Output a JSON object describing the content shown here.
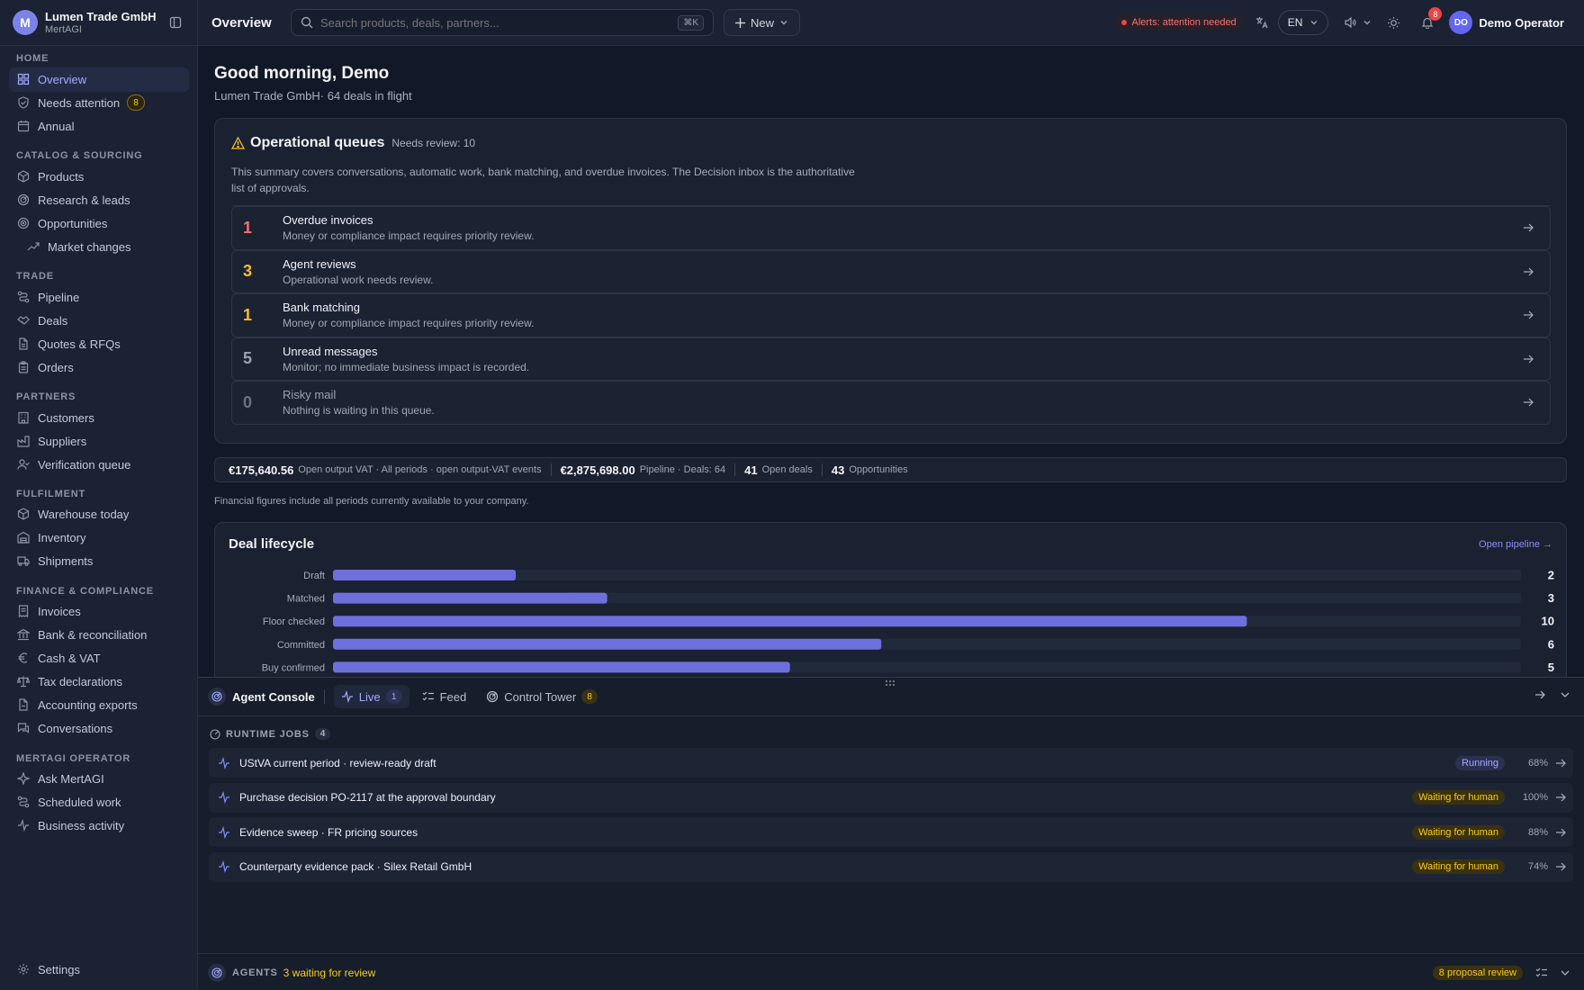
{
  "brand": {
    "name": "Lumen Trade GmbH",
    "sub": "MertAGI",
    "logo": "M"
  },
  "sidebar": {
    "sections": [
      {
        "label": "HOME",
        "items": [
          {
            "label": "Overview",
            "icon": "grid-icon",
            "active": true
          },
          {
            "label": "Needs attention",
            "icon": "shield-check-icon",
            "badge": "8"
          },
          {
            "label": "Annual",
            "icon": "calendar-icon"
          }
        ]
      },
      {
        "label": "CATALOG & SOURCING",
        "items": [
          {
            "label": "Products",
            "icon": "box-icon"
          },
          {
            "label": "Research & leads",
            "icon": "radar-icon"
          },
          {
            "label": "Opportunities",
            "icon": "target-icon"
          },
          {
            "label": "Market changes",
            "icon": "trend-icon",
            "sub": true
          }
        ]
      },
      {
        "label": "TRADE",
        "items": [
          {
            "label": "Pipeline",
            "icon": "route-icon"
          },
          {
            "label": "Deals",
            "icon": "handshake-icon"
          },
          {
            "label": "Quotes & RFQs",
            "icon": "file-icon"
          },
          {
            "label": "Orders",
            "icon": "clipboard-icon"
          }
        ]
      },
      {
        "label": "PARTNERS",
        "items": [
          {
            "label": "Customers",
            "icon": "building-icon"
          },
          {
            "label": "Suppliers",
            "icon": "factory-icon"
          },
          {
            "label": "Verification queue",
            "icon": "user-check-icon"
          }
        ]
      },
      {
        "label": "FULFILMENT",
        "items": [
          {
            "label": "Warehouse today",
            "icon": "box-icon"
          },
          {
            "label": "Inventory",
            "icon": "warehouse-icon"
          },
          {
            "label": "Shipments",
            "icon": "truck-icon"
          }
        ]
      },
      {
        "label": "FINANCE & COMPLIANCE",
        "items": [
          {
            "label": "Invoices",
            "icon": "receipt-icon"
          },
          {
            "label": "Bank & reconciliation",
            "icon": "bank-icon"
          },
          {
            "label": "Cash & VAT",
            "icon": "euro-icon"
          },
          {
            "label": "Tax declarations",
            "icon": "scale-icon"
          },
          {
            "label": "Accounting exports",
            "icon": "export-icon"
          },
          {
            "label": "Conversations",
            "icon": "chat-icon"
          }
        ]
      },
      {
        "label": "MERTAGI OPERATOR",
        "items": [
          {
            "label": "Ask MertAGI",
            "icon": "sparkle-icon"
          },
          {
            "label": "Scheduled work",
            "icon": "route-icon"
          },
          {
            "label": "Business activity",
            "icon": "activity-icon"
          }
        ]
      }
    ],
    "settings": "Settings"
  },
  "topbar": {
    "title": "Overview",
    "search_placeholder": "Search products, deals, partners...",
    "search_kbd": "⌘K",
    "new_label": "New",
    "alert": "Alerts: attention needed",
    "lang": "EN",
    "bell_count": "8",
    "avatar": "DO",
    "user": "Demo Operator"
  },
  "greeting": {
    "title": "Good morning, Demo",
    "sub": "Lumen Trade GmbH· 64 deals in flight"
  },
  "queues": {
    "title": "Operational queues",
    "needs_review": "Needs review: 10",
    "description": "This summary covers conversations, automatic work, bank matching, and overdue invoices. The Decision inbox is the authoritative list of approvals.",
    "rows": [
      {
        "count": "1",
        "name": "Overdue invoices",
        "note": "Money or compliance impact requires priority review.",
        "color": "#f87171"
      },
      {
        "count": "3",
        "name": "Agent reviews",
        "note": "Operational work needs review.",
        "color": "#fbbf24"
      },
      {
        "count": "1",
        "name": "Bank matching",
        "note": "Money or compliance impact requires priority review.",
        "color": "#fbbf24"
      },
      {
        "count": "5",
        "name": "Unread messages",
        "note": "Monitor; no immediate business impact is recorded.",
        "color": "#9ca3af"
      },
      {
        "count": "0",
        "name": "Risky mail",
        "note": "Nothing is waiting in this queue.",
        "color": "#6b7280"
      }
    ]
  },
  "metrics": [
    {
      "value": "€175,640.56",
      "label": "Open output VAT · All periods · open output-VAT events"
    },
    {
      "value": "€2,875,698.00",
      "label": "Pipeline · Deals: 64"
    },
    {
      "value": "41",
      "label": "Open deals"
    },
    {
      "value": "43",
      "label": "Opportunities"
    }
  ],
  "financial_note": "Financial figures include all periods currently available to your company.",
  "lifecycle": {
    "title": "Deal lifecycle",
    "link": "Open pipeline →"
  },
  "chart_data": {
    "type": "bar",
    "orientation": "horizontal",
    "categories": [
      "Draft",
      "Matched",
      "Floor checked",
      "Committed",
      "Buy confirmed"
    ],
    "values": [
      2,
      3,
      10,
      6,
      5
    ],
    "xlim": [
      0,
      13
    ],
    "color": "#6d70dc"
  },
  "console": {
    "title": "Agent Console",
    "tabs": [
      {
        "label": "Live",
        "count": "1",
        "active": true,
        "icon": "activity-icon"
      },
      {
        "label": "Feed",
        "icon": "list-icon"
      },
      {
        "label": "Control Tower",
        "count": "8",
        "icon": "radar-icon"
      }
    ],
    "runtime_label": "RUNTIME JOBS",
    "runtime_count": "4",
    "jobs": [
      {
        "title": "UStVA current period · review-ready draft",
        "status": "Running",
        "kind": "run",
        "pct": "68%"
      },
      {
        "title": "Purchase decision PO-2117 at the approval boundary",
        "status": "Waiting for human",
        "kind": "wait",
        "pct": "100%"
      },
      {
        "title": "Evidence sweep · FR pricing sources",
        "status": "Waiting for human",
        "kind": "wait",
        "pct": "88%"
      },
      {
        "title": "Counterparty evidence pack · Silex Retail GmbH",
        "status": "Waiting for human",
        "kind": "wait",
        "pct": "74%"
      }
    ],
    "agents_label": "AGENTS",
    "agents_waiting": "3 waiting for review",
    "proposal": "8 proposal review"
  }
}
